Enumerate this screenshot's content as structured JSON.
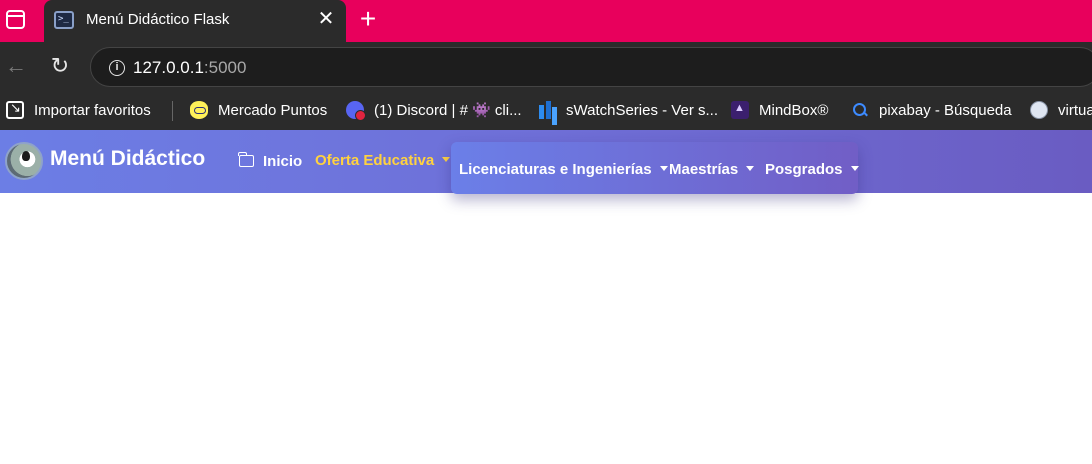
{
  "browser": {
    "tab": {
      "title": "Menú Didáctico Flask",
      "favicon_glyph": ">_",
      "close_glyph": "✕"
    },
    "new_tab_glyph": "+",
    "back_glyph": "←",
    "reload_glyph": "↻",
    "info_glyph": "i",
    "address": {
      "host": "127.0.0.1",
      "port": ":5000"
    },
    "bookmarks": [
      {
        "label": "Importar favoritos",
        "icon": "import-icon"
      },
      {
        "label": "Mercado Puntos",
        "icon": "mercado-icon"
      },
      {
        "label": "(1) Discord | # 👾 cli...",
        "icon": "discord-icon"
      },
      {
        "label": "sWatchSeries - Ver s...",
        "icon": "swatchseries-icon"
      },
      {
        "label": "MindBox®",
        "icon": "mindbox-icon"
      },
      {
        "label": "pixabay - Búsqueda",
        "icon": "search-icon"
      },
      {
        "label": "virtua",
        "icon": "globe-icon"
      }
    ],
    "colors": {
      "tabstrip": "#e8005c",
      "chrome_dark": "#2b2b2b"
    }
  },
  "site": {
    "brand": "Menú Didáctico",
    "nav": {
      "home": "Inicio",
      "oferta": "Oferta Educativa"
    },
    "dropdown": {
      "items": [
        "Licenciaturas e Ingenierías",
        "Maestrías",
        "Posgrados"
      ]
    },
    "colors": {
      "navbar_start": "#6c7ee5",
      "navbar_end": "#6a5cc2",
      "active_link": "#ffd23f"
    }
  }
}
